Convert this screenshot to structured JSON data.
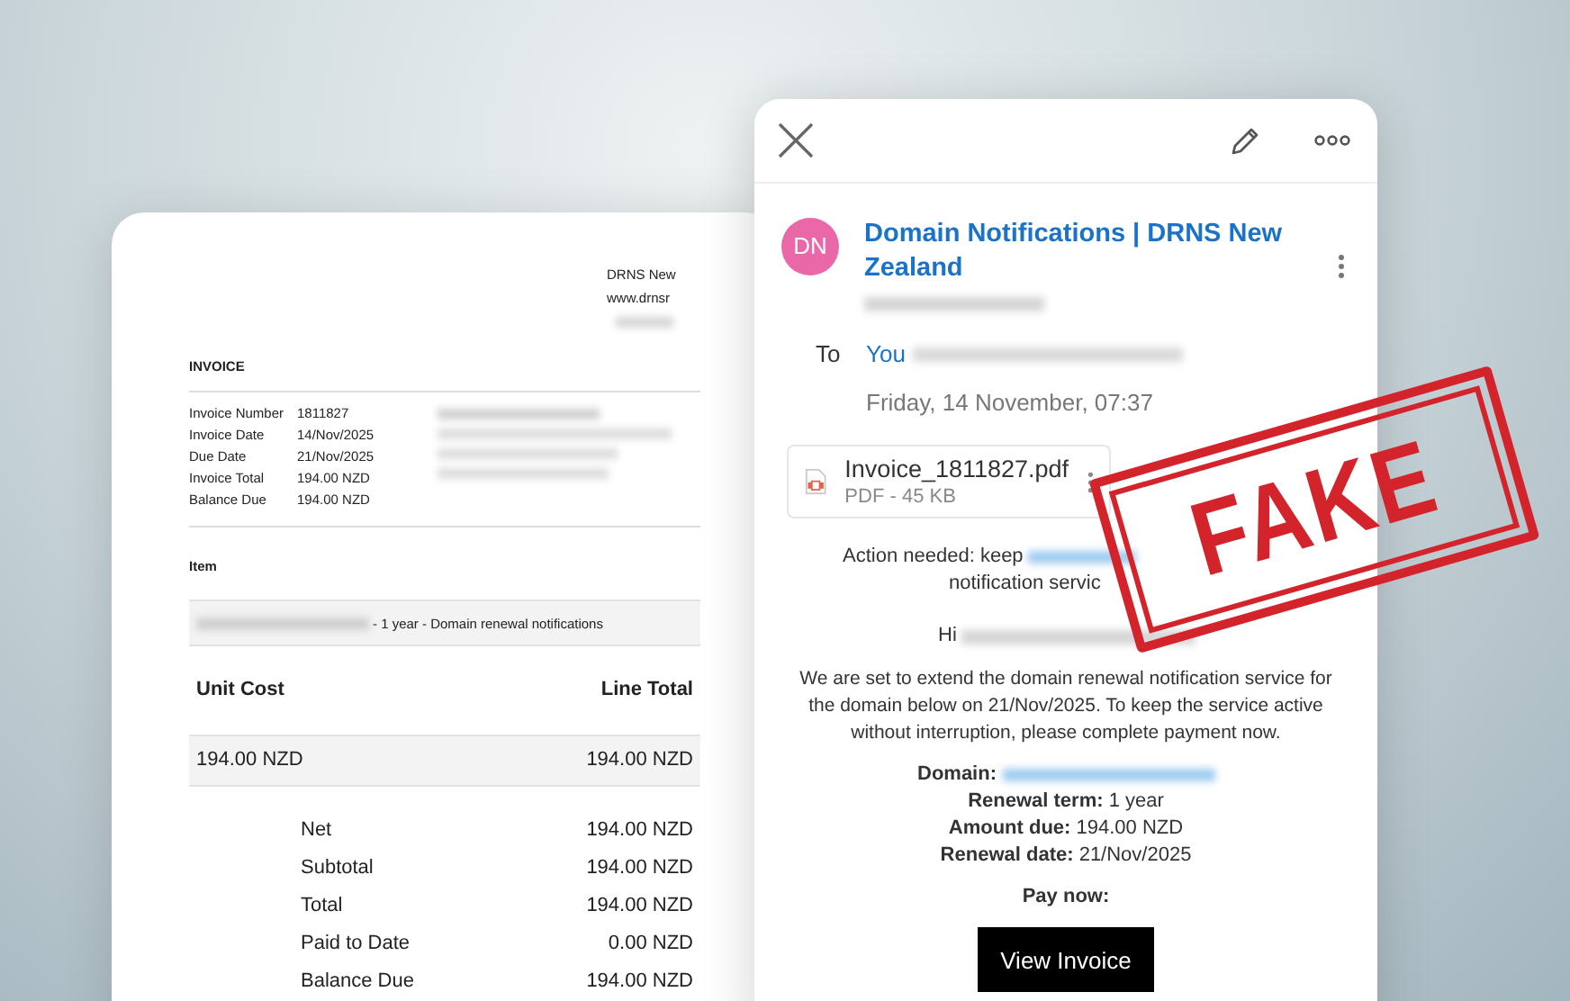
{
  "invoice": {
    "company_lines": [
      "DRNS New",
      "www.drnsr"
    ],
    "title": "INVOICE",
    "details": [
      {
        "label": "Invoice Number",
        "value": "1811827"
      },
      {
        "label": "Invoice Date",
        "value": "14/Nov/2025"
      },
      {
        "label": "Due Date",
        "value": "21/Nov/2025"
      },
      {
        "label": "Invoice Total",
        "value": "194.00 NZD"
      },
      {
        "label": "Balance Due",
        "value": "194.00 NZD"
      }
    ],
    "item_heading": "Item",
    "item_description": "- 1 year - Domain renewal notifications",
    "columns": [
      "Unit Cost",
      "Line Total"
    ],
    "line": [
      "194.00 NZD",
      "194.00 NZD"
    ],
    "totals": [
      {
        "label": "Net",
        "value": "194.00 NZD"
      },
      {
        "label": "Subtotal",
        "value": "194.00 NZD"
      },
      {
        "label": "Total",
        "value": "194.00 NZD"
      },
      {
        "label": "Paid to Date",
        "value": "0.00 NZD"
      },
      {
        "label": "Balance Due",
        "value": "194.00 NZD"
      }
    ]
  },
  "email": {
    "sender_initials": "DN",
    "sender_name": "Domain Notifications | DRNS New Zealand",
    "to_label": "To",
    "recipient": "You",
    "date": "Friday, 14 November, 07:37",
    "attachment": {
      "name": "Invoice_1811827.pdf",
      "meta": "PDF - 45 KB"
    },
    "action_lines": [
      "Action needed: keep",
      "notification servic"
    ],
    "greeting": "Hi",
    "body": "We are set to extend the domain renewal notification service for the domain below on 21/Nov/2025. To keep the service active without interruption, please complete payment now.",
    "domain_label": "Domain:",
    "facts": [
      "**Renewal term:** 1 year",
      "**Amount due:** 194.00 NZD",
      "**Renewal date:** 21/Nov/2025"
    ],
    "pay_label": "Pay now:",
    "button": "View Invoice"
  },
  "stamp": {
    "text": "FAKE"
  }
}
